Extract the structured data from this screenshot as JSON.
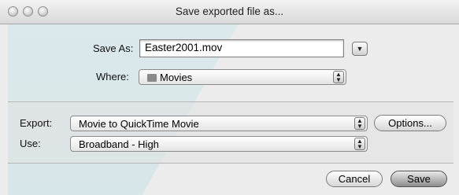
{
  "window": {
    "title": "Save exported file as..."
  },
  "save_as": {
    "label": "Save As:",
    "value": "Easter2001.mov"
  },
  "where": {
    "label": "Where:",
    "value": "Movies",
    "icon": "folder-icon"
  },
  "export": {
    "label": "Export:",
    "value": "Movie to QuickTime Movie",
    "options_label": "Options..."
  },
  "use": {
    "label": "Use:",
    "value": "Broadband - High"
  },
  "buttons": {
    "cancel": "Cancel",
    "save": "Save"
  }
}
